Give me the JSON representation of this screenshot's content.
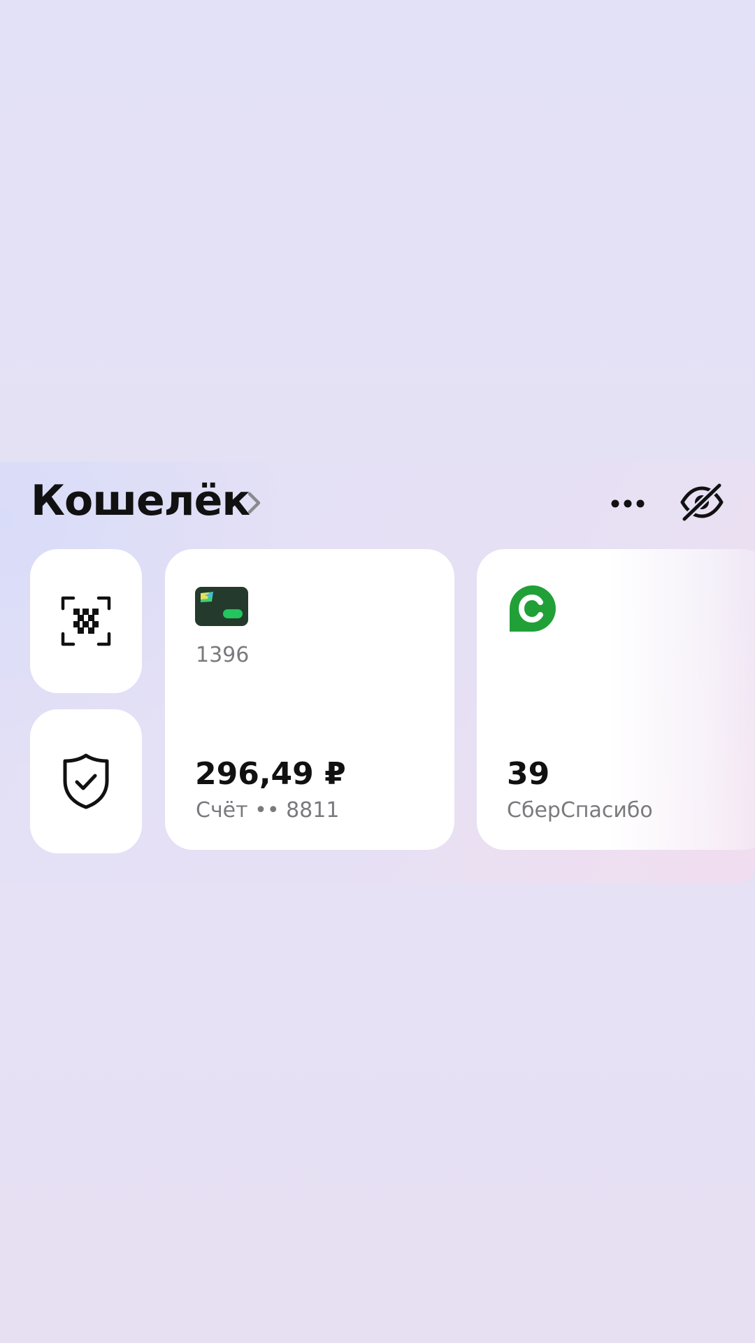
{
  "wallet": {
    "title": "Кошелёк",
    "chevron_icon": "chevron-right-icon",
    "more_icon": "more-dots-icon",
    "hide_icon": "eye-crossed-icon",
    "quick_actions": [
      {
        "icon": "qr-scan-icon"
      },
      {
        "icon": "shield-check-icon"
      }
    ],
    "account_card": {
      "icon": "card-icon",
      "card_number": "1396",
      "amount": "296,49 ₽",
      "caption": "Счёт •• 8811"
    },
    "spasibo_card": {
      "icon": "sberspasibo-logo",
      "amount": "39",
      "caption": "СберСпасибо",
      "brand_color": "#21a038"
    }
  }
}
